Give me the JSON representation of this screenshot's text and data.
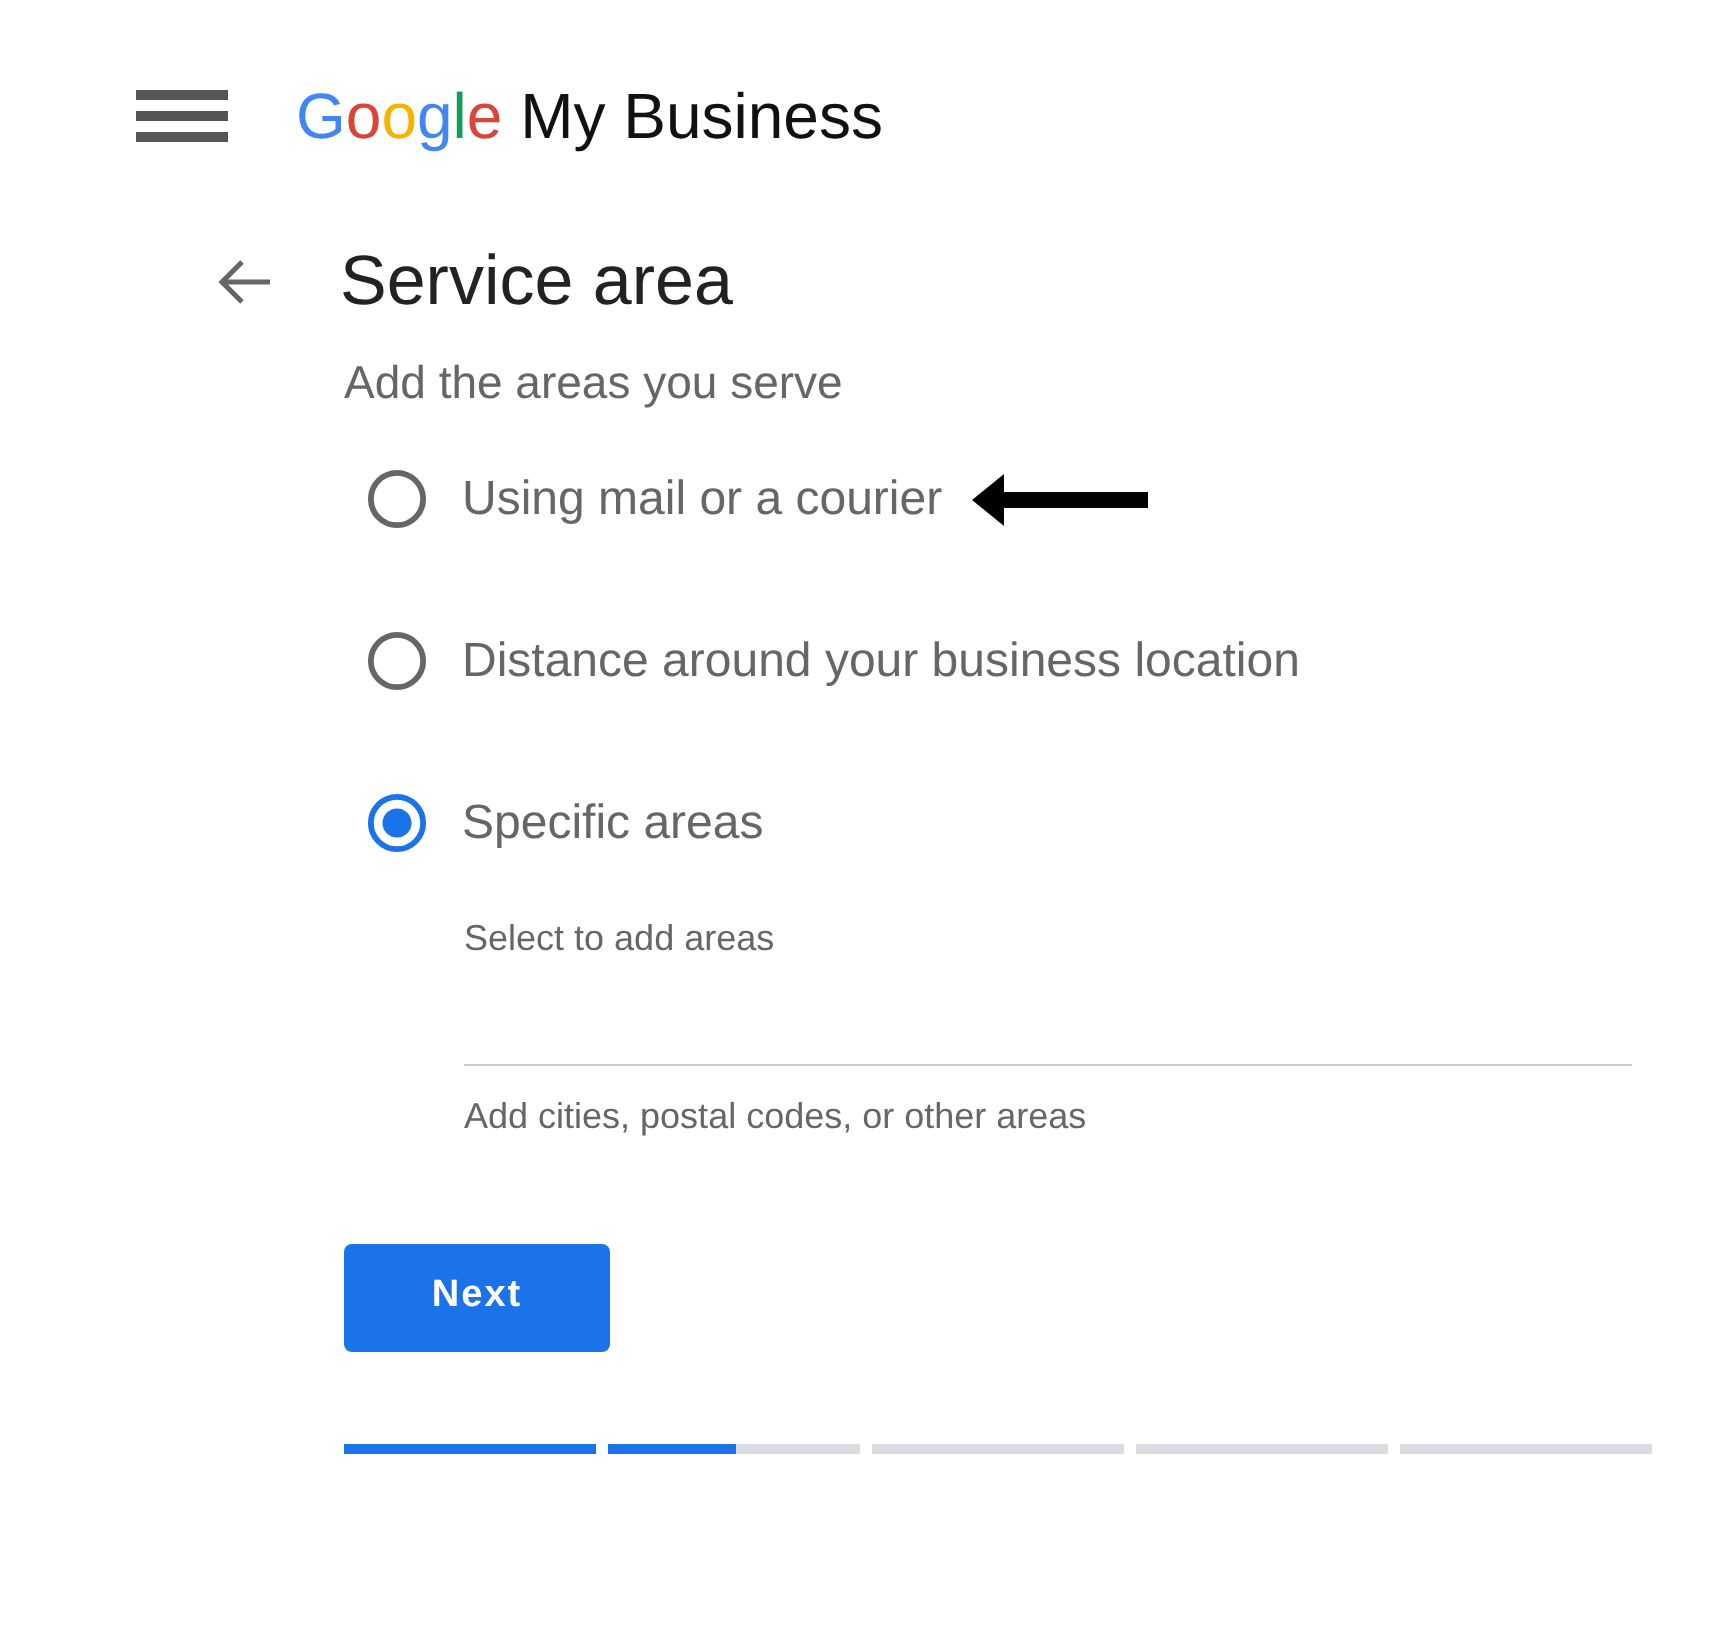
{
  "header": {
    "brand": "Google",
    "product": "My Business"
  },
  "page": {
    "title": "Service area",
    "subtitle": "Add the areas you serve"
  },
  "options": [
    {
      "label": "Using mail or a courier",
      "selected": false
    },
    {
      "label": "Distance around your business location",
      "selected": false
    },
    {
      "label": "Specific areas",
      "selected": true
    }
  ],
  "area_field": {
    "label": "Select to add areas",
    "helper": "Add cities, postal codes, or other areas"
  },
  "next_button": "Next",
  "progress": {
    "level": 0.3
  }
}
